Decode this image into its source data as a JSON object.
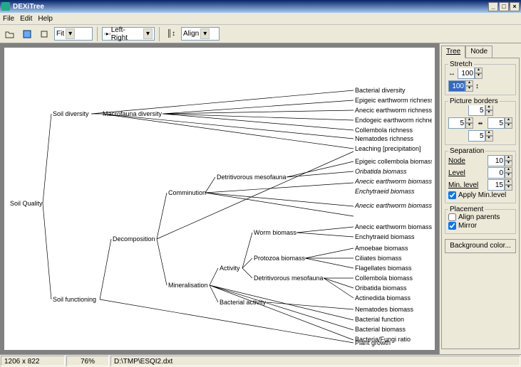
{
  "window": {
    "title": "DEXiTree"
  },
  "menu": {
    "file": "File",
    "edit": "Edit",
    "help": "Help"
  },
  "toolbar": {
    "fit": "Fit",
    "layout": "Left-Right",
    "align": "Align"
  },
  "panel": {
    "tabs": {
      "tree": "Tree",
      "node": "Node"
    },
    "stretch": {
      "title": "Stretch",
      "x": "100",
      "y": "100"
    },
    "borders": {
      "title": "Picture borders",
      "top": "5",
      "left": "5",
      "right": "5",
      "bottom": "5"
    },
    "separation": {
      "title": "Separation",
      "node_l": "Node",
      "node_v": "10",
      "level_l": "Level",
      "level_v": "0",
      "min_l": "Min. level",
      "min_v": "15",
      "apply": "Apply Min.level"
    },
    "placement": {
      "title": "Placement",
      "align": "Align parents",
      "mirror": "Mirror"
    },
    "bg": "Background color..."
  },
  "status": {
    "dims": "1206 x 822",
    "zoom": "76%",
    "path": "D:\\TMP\\ESQI2.dxt"
  },
  "tree": {
    "root": "Soil Quality",
    "soil_diversity": "Soil diversity",
    "macro": "Macrofauna diversity",
    "bact_div": "Bacterial diversity",
    "epi_earth_rich": "Epigeic earthworm richness",
    "anec_earth_rich": "Anecic earthworm richness",
    "endo_earth_rich": "Endogeic earthworm richness",
    "collem_rich": "Collembola richness",
    "nema_rich": "Nematodes richness",
    "soil_func": "Soil functioning",
    "decomp": "Decomposition",
    "leach": "Leaching [precipitation]",
    "comm": "Comminution",
    "det_meso": "Detritivorous mesofauna",
    "epi_coll_bio": "Epigeic collembola biomass",
    "orib_bio": "Oribatida biomass",
    "anec_earth_bio": "Anecic earthworm biomass",
    "ench_bio": "Enchytraeid biomass",
    "miner": "Mineralisation",
    "activity": "Activity",
    "worm_bio": "Worm biomass",
    "anec_earth_bio2": "Anecic earthworm biomass",
    "ench_bio2": "Enchytraeid biomass",
    "proto_bio": "Protozoa biomass",
    "amoeb": "Amoebae biomass",
    "cili": "Ciliates biomass",
    "flag": "Flagellates biomass",
    "bact_act": "Bacterial activity",
    "det_meso2": "Detritivorous mesofauna",
    "coll_bio": "Collembola biomass",
    "orib_bio2": "Oribatida biomass",
    "actin": "Actinedida biomass",
    "nema_bio": "Nematodes biomass",
    "bact_func": "Bacterial function",
    "bact_bio": "Bacterial biomass",
    "bf_ratio": "Bacteria/Fungi ratio",
    "plant": "Plant growth"
  }
}
